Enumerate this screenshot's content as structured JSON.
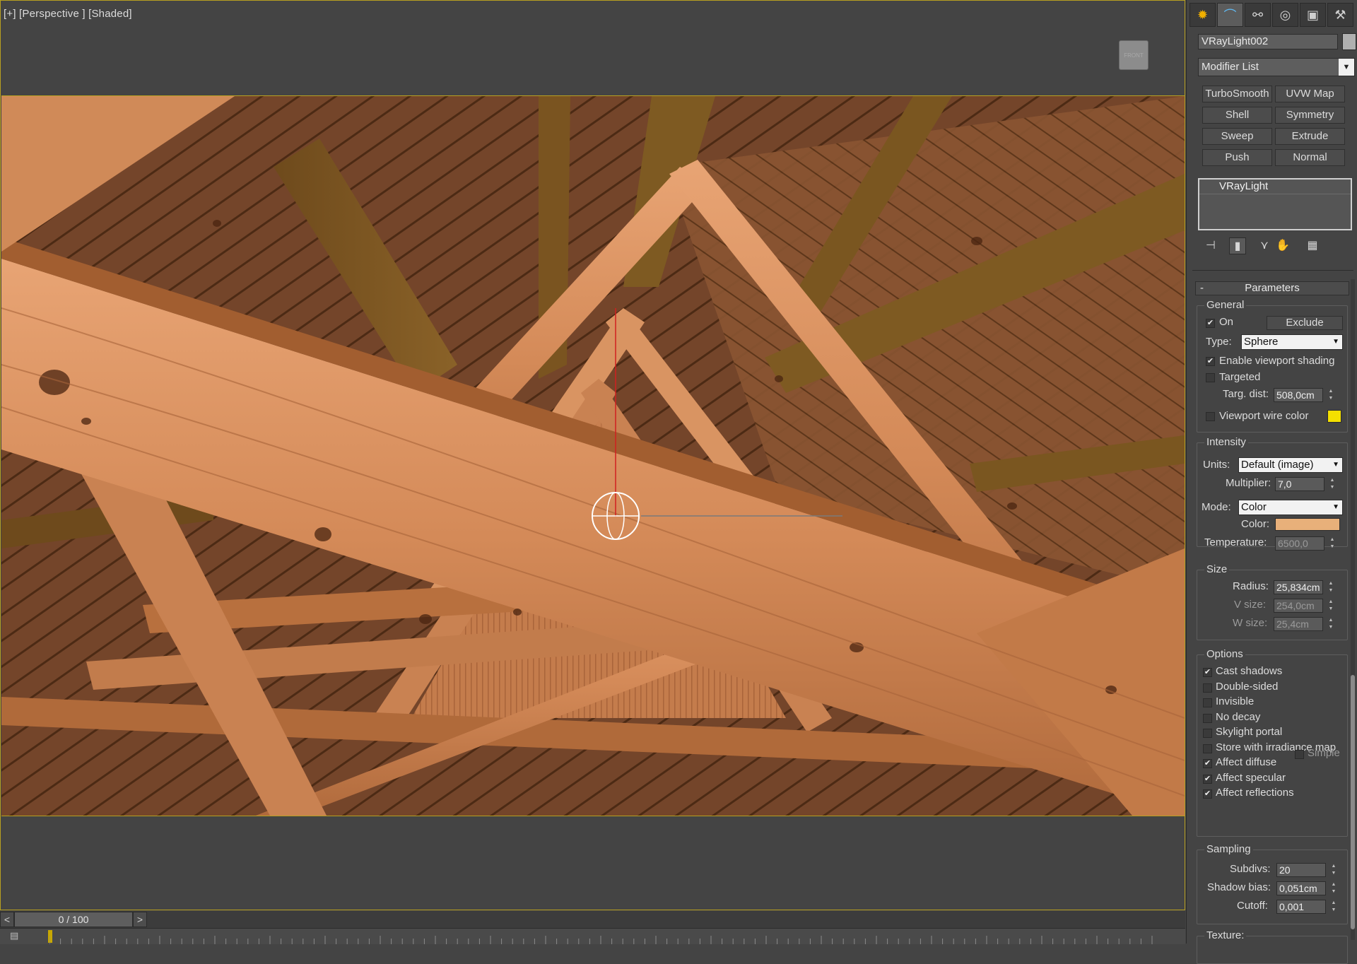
{
  "viewport": {
    "label": "[+] [Perspective ] [Shaded]",
    "viewcube_label": "FRONT"
  },
  "timeslider": {
    "position": "0 / 100",
    "prev": "<",
    "next": ">"
  },
  "command_panel": {
    "tabs": [
      {
        "name": "create-tab",
        "icon": "sun-icon"
      },
      {
        "name": "modify-tab",
        "icon": "modify-curve-icon",
        "active": true
      },
      {
        "name": "hierarchy-tab",
        "icon": "hierarchy-icon"
      },
      {
        "name": "motion-tab",
        "icon": "motion-icon"
      },
      {
        "name": "display-tab",
        "icon": "monitor-icon"
      },
      {
        "name": "utilities-tab",
        "icon": "hammer-icon"
      }
    ],
    "object_name": "VRayLight002",
    "object_color": "#b0b0b0",
    "modifier_list": "Modifier List",
    "modifier_buttons": [
      "TurboSmooth",
      "UVW Map",
      "Shell",
      "Symmetry",
      "Sweep",
      "Extrude",
      "Push",
      "Normal"
    ],
    "stack_item": "VRayLight",
    "parameters": {
      "title": "Parameters",
      "collapse": "-",
      "general": {
        "title": "General",
        "on_label": "On",
        "on_checked": true,
        "exclude_label": "Exclude",
        "type_label": "Type:",
        "type_value": "Sphere",
        "viewport_shading_label": "Enable viewport shading",
        "viewport_shading_checked": true,
        "targeted_label": "Targeted",
        "targeted_checked": false,
        "targ_dist_label": "Targ. dist:",
        "targ_dist_value": "508,0cm",
        "wire_color_label": "Viewport wire color",
        "wire_color_checked": false,
        "wire_color": "#f4e000"
      },
      "intensity": {
        "title": "Intensity",
        "units_label": "Units:",
        "units_value": "Default (image)",
        "multiplier_label": "Multiplier:",
        "multiplier_value": "7,0",
        "mode_label": "Mode:",
        "mode_value": "Color",
        "color_label": "Color:",
        "color": "#e8b07a",
        "temperature_label": "Temperature:",
        "temperature_value": "6500,0"
      },
      "size": {
        "title": "Size",
        "radius_label": "Radius:",
        "radius_value": "25,834cm",
        "v_size_label": "V size:",
        "v_size_value": "254,0cm",
        "w_size_label": "W size:",
        "w_size_value": "25,4cm"
      },
      "options": {
        "title": "Options",
        "items": [
          {
            "label": "Cast shadows",
            "checked": true
          },
          {
            "label": "Double-sided",
            "checked": false
          },
          {
            "label": "Invisible",
            "checked": false
          },
          {
            "label": "No decay",
            "checked": false
          },
          {
            "label": "Skylight portal",
            "checked": false
          },
          {
            "label": "Store with irradiance map",
            "checked": false
          },
          {
            "label": "Affect diffuse",
            "checked": true
          },
          {
            "label": "Affect specular",
            "checked": true
          },
          {
            "label": "Affect reflections",
            "checked": true
          }
        ],
        "simple_label": "Simple"
      },
      "sampling": {
        "title": "Sampling",
        "subdivs_label": "Subdivs:",
        "subdivs_value": "20",
        "shadow_bias_label": "Shadow bias:",
        "shadow_bias_value": "0,051cm",
        "cutoff_label": "Cutoff:",
        "cutoff_value": "0,001"
      },
      "texture": {
        "title": "Texture:"
      }
    }
  }
}
